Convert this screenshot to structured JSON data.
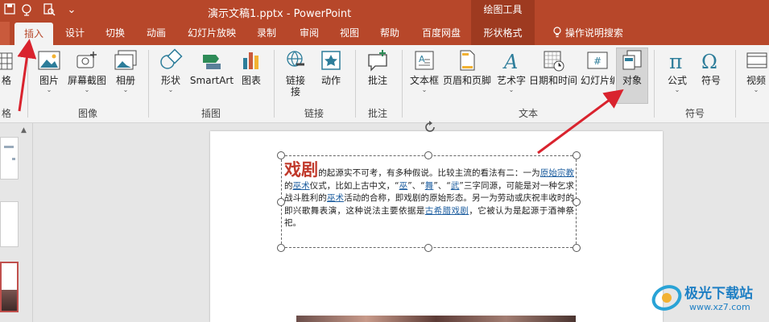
{
  "title_bar": {
    "document_title": "演示文稿1.pptx",
    "separator": " - ",
    "app_name": "PowerPoint",
    "context_group": "绘图工具",
    "qa_menu": "⌄"
  },
  "tabs": [
    "插入",
    "设计",
    "切换",
    "动画",
    "幻灯片放映",
    "录制",
    "审阅",
    "视图",
    "帮助",
    "百度网盘",
    "形状格式",
    "操作说明搜索"
  ],
  "ribbon": {
    "partial_left": {
      "table_label": "格",
      "table_group": "格"
    },
    "image_group": {
      "label": "图像",
      "buttons": [
        "图片",
        "屏幕截图",
        "相册"
      ]
    },
    "illustration_group": {
      "label": "插图",
      "buttons": [
        "形状",
        "SmartArt",
        "图表"
      ]
    },
    "link_group": {
      "label": "链接",
      "buttons": [
        "链接",
        "动作"
      ],
      "link_line2": "接"
    },
    "comment_group": {
      "label": "批注",
      "buttons": [
        "批注"
      ]
    },
    "text_group": {
      "label": "文本",
      "buttons": [
        "文本框",
        "页眉和页脚",
        "艺术字",
        "日期和时间",
        "幻灯片编号",
        "对象"
      ],
      "slide_num_line2": "编号"
    },
    "symbol_group": {
      "label": "符号",
      "buttons": [
        "公式",
        "符号"
      ]
    },
    "media_partial": "视频"
  },
  "slide": {
    "heading": "戏剧",
    "runs": [
      {
        "t": "的起源实不可考，有多种假说。比较主流的看法有二：一为",
        "link": false
      },
      {
        "t": "原始宗教",
        "link": true
      },
      {
        "t": "的",
        "link": false
      },
      {
        "t": "巫术",
        "link": true
      },
      {
        "t": "仪式，比如上古中文，“",
        "link": false
      },
      {
        "t": "巫",
        "link": true
      },
      {
        "t": "”、“",
        "link": false
      },
      {
        "t": "舞",
        "link": true
      },
      {
        "t": "”、“",
        "link": false
      },
      {
        "t": "武",
        "link": true
      },
      {
        "t": "”三字同源，可能是对一种乞求战斗胜利的",
        "link": false
      },
      {
        "t": "巫术",
        "link": true
      },
      {
        "t": "活动的合称，即戏剧的原始形态。另一为劳动或庆祝丰收时的即兴歌舞表演，这种说法主要依据是",
        "link": false
      },
      {
        "t": "古希腊戏剧",
        "link": true
      },
      {
        "t": "，它被认为是起源于酒神祭祀。",
        "link": false
      }
    ]
  },
  "watermark": {
    "name": "极光下载站",
    "url": "www.xz7.com"
  },
  "colors": {
    "brand": "#b7472a",
    "annotation_arrow": "#d9232e",
    "link": "#1f5fa0"
  }
}
